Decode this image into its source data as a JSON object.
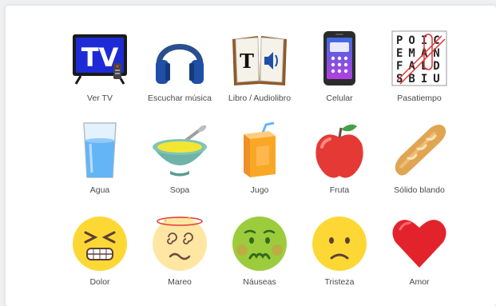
{
  "board": {
    "items": [
      {
        "label": "Ver TV",
        "icon": "tv-icon"
      },
      {
        "label": "Escuchar música",
        "icon": "headphones-icon"
      },
      {
        "label": "Libro / Audiolibro",
        "icon": "book-icon"
      },
      {
        "label": "Celular",
        "icon": "cellphone-icon"
      },
      {
        "label": "Pasatiempo",
        "icon": "word-search-icon"
      },
      {
        "label": "Agua",
        "icon": "water-glass-icon"
      },
      {
        "label": "Sopa",
        "icon": "soup-bowl-icon"
      },
      {
        "label": "Jugo",
        "icon": "juice-box-icon"
      },
      {
        "label": "Fruta",
        "icon": "apple-icon"
      },
      {
        "label": "Sólido blando",
        "icon": "bread-icon"
      },
      {
        "label": "Dolor",
        "icon": "pain-face-icon"
      },
      {
        "label": "Mareo",
        "icon": "dizzy-face-icon"
      },
      {
        "label": "Náuseas",
        "icon": "nauseated-face-icon"
      },
      {
        "label": "Tristeza",
        "icon": "sad-face-icon"
      },
      {
        "label": "Amor",
        "icon": "heart-icon"
      }
    ],
    "tv_letters": "TV",
    "book_letter": "T",
    "wordsearch_rows": [
      "POIC",
      "EMAN",
      "FALD",
      "SBIU"
    ]
  }
}
